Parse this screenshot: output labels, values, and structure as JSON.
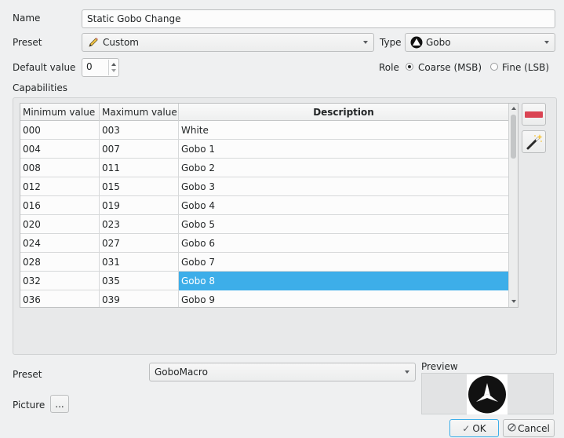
{
  "form": {
    "name_label": "Name",
    "name_value": "Static Gobo Change",
    "preset_label": "Preset",
    "preset_value": "Custom",
    "type_label": "Type",
    "type_value": "Gobo",
    "default_label": "Default value",
    "default_value": "0",
    "role_label": "Role",
    "role_coarse": "Coarse (MSB)",
    "role_fine": "Fine (LSB)",
    "role_selected": "coarse"
  },
  "capabilities": {
    "label": "Capabilities",
    "columns": [
      "Minimum value",
      "Maximum value",
      "Description"
    ],
    "rows": [
      {
        "min": "000",
        "max": "003",
        "desc": "White",
        "selected": false
      },
      {
        "min": "004",
        "max": "007",
        "desc": "Gobo 1",
        "selected": false
      },
      {
        "min": "008",
        "max": "011",
        "desc": "Gobo 2",
        "selected": false
      },
      {
        "min": "012",
        "max": "015",
        "desc": "Gobo 3",
        "selected": false
      },
      {
        "min": "016",
        "max": "019",
        "desc": "Gobo 4",
        "selected": false
      },
      {
        "min": "020",
        "max": "023",
        "desc": "Gobo 5",
        "selected": false
      },
      {
        "min": "024",
        "max": "027",
        "desc": "Gobo 6",
        "selected": false
      },
      {
        "min": "028",
        "max": "031",
        "desc": "Gobo 7",
        "selected": false
      },
      {
        "min": "032",
        "max": "035",
        "desc": "Gobo 8",
        "selected": true
      },
      {
        "min": "036",
        "max": "039",
        "desc": "Gobo 9",
        "selected": false
      }
    ]
  },
  "capability_preset": {
    "label": "Preset",
    "value": "GoboMacro",
    "preview_label": "Preview",
    "picture_label": "Picture",
    "picture_button": "..."
  },
  "buttons": {
    "ok": "OK",
    "cancel": "Cancel"
  },
  "icons": {
    "preset_icon": "pencil-icon",
    "type_icon": "gobo-icon",
    "remove_icon": "remove-icon",
    "wizard_icon": "magic-wand-icon",
    "ok_icon": "checkmark-icon",
    "cancel_icon": "cancel-icon"
  },
  "colors": {
    "selection": "#3daee9",
    "remove": "#da4453"
  }
}
